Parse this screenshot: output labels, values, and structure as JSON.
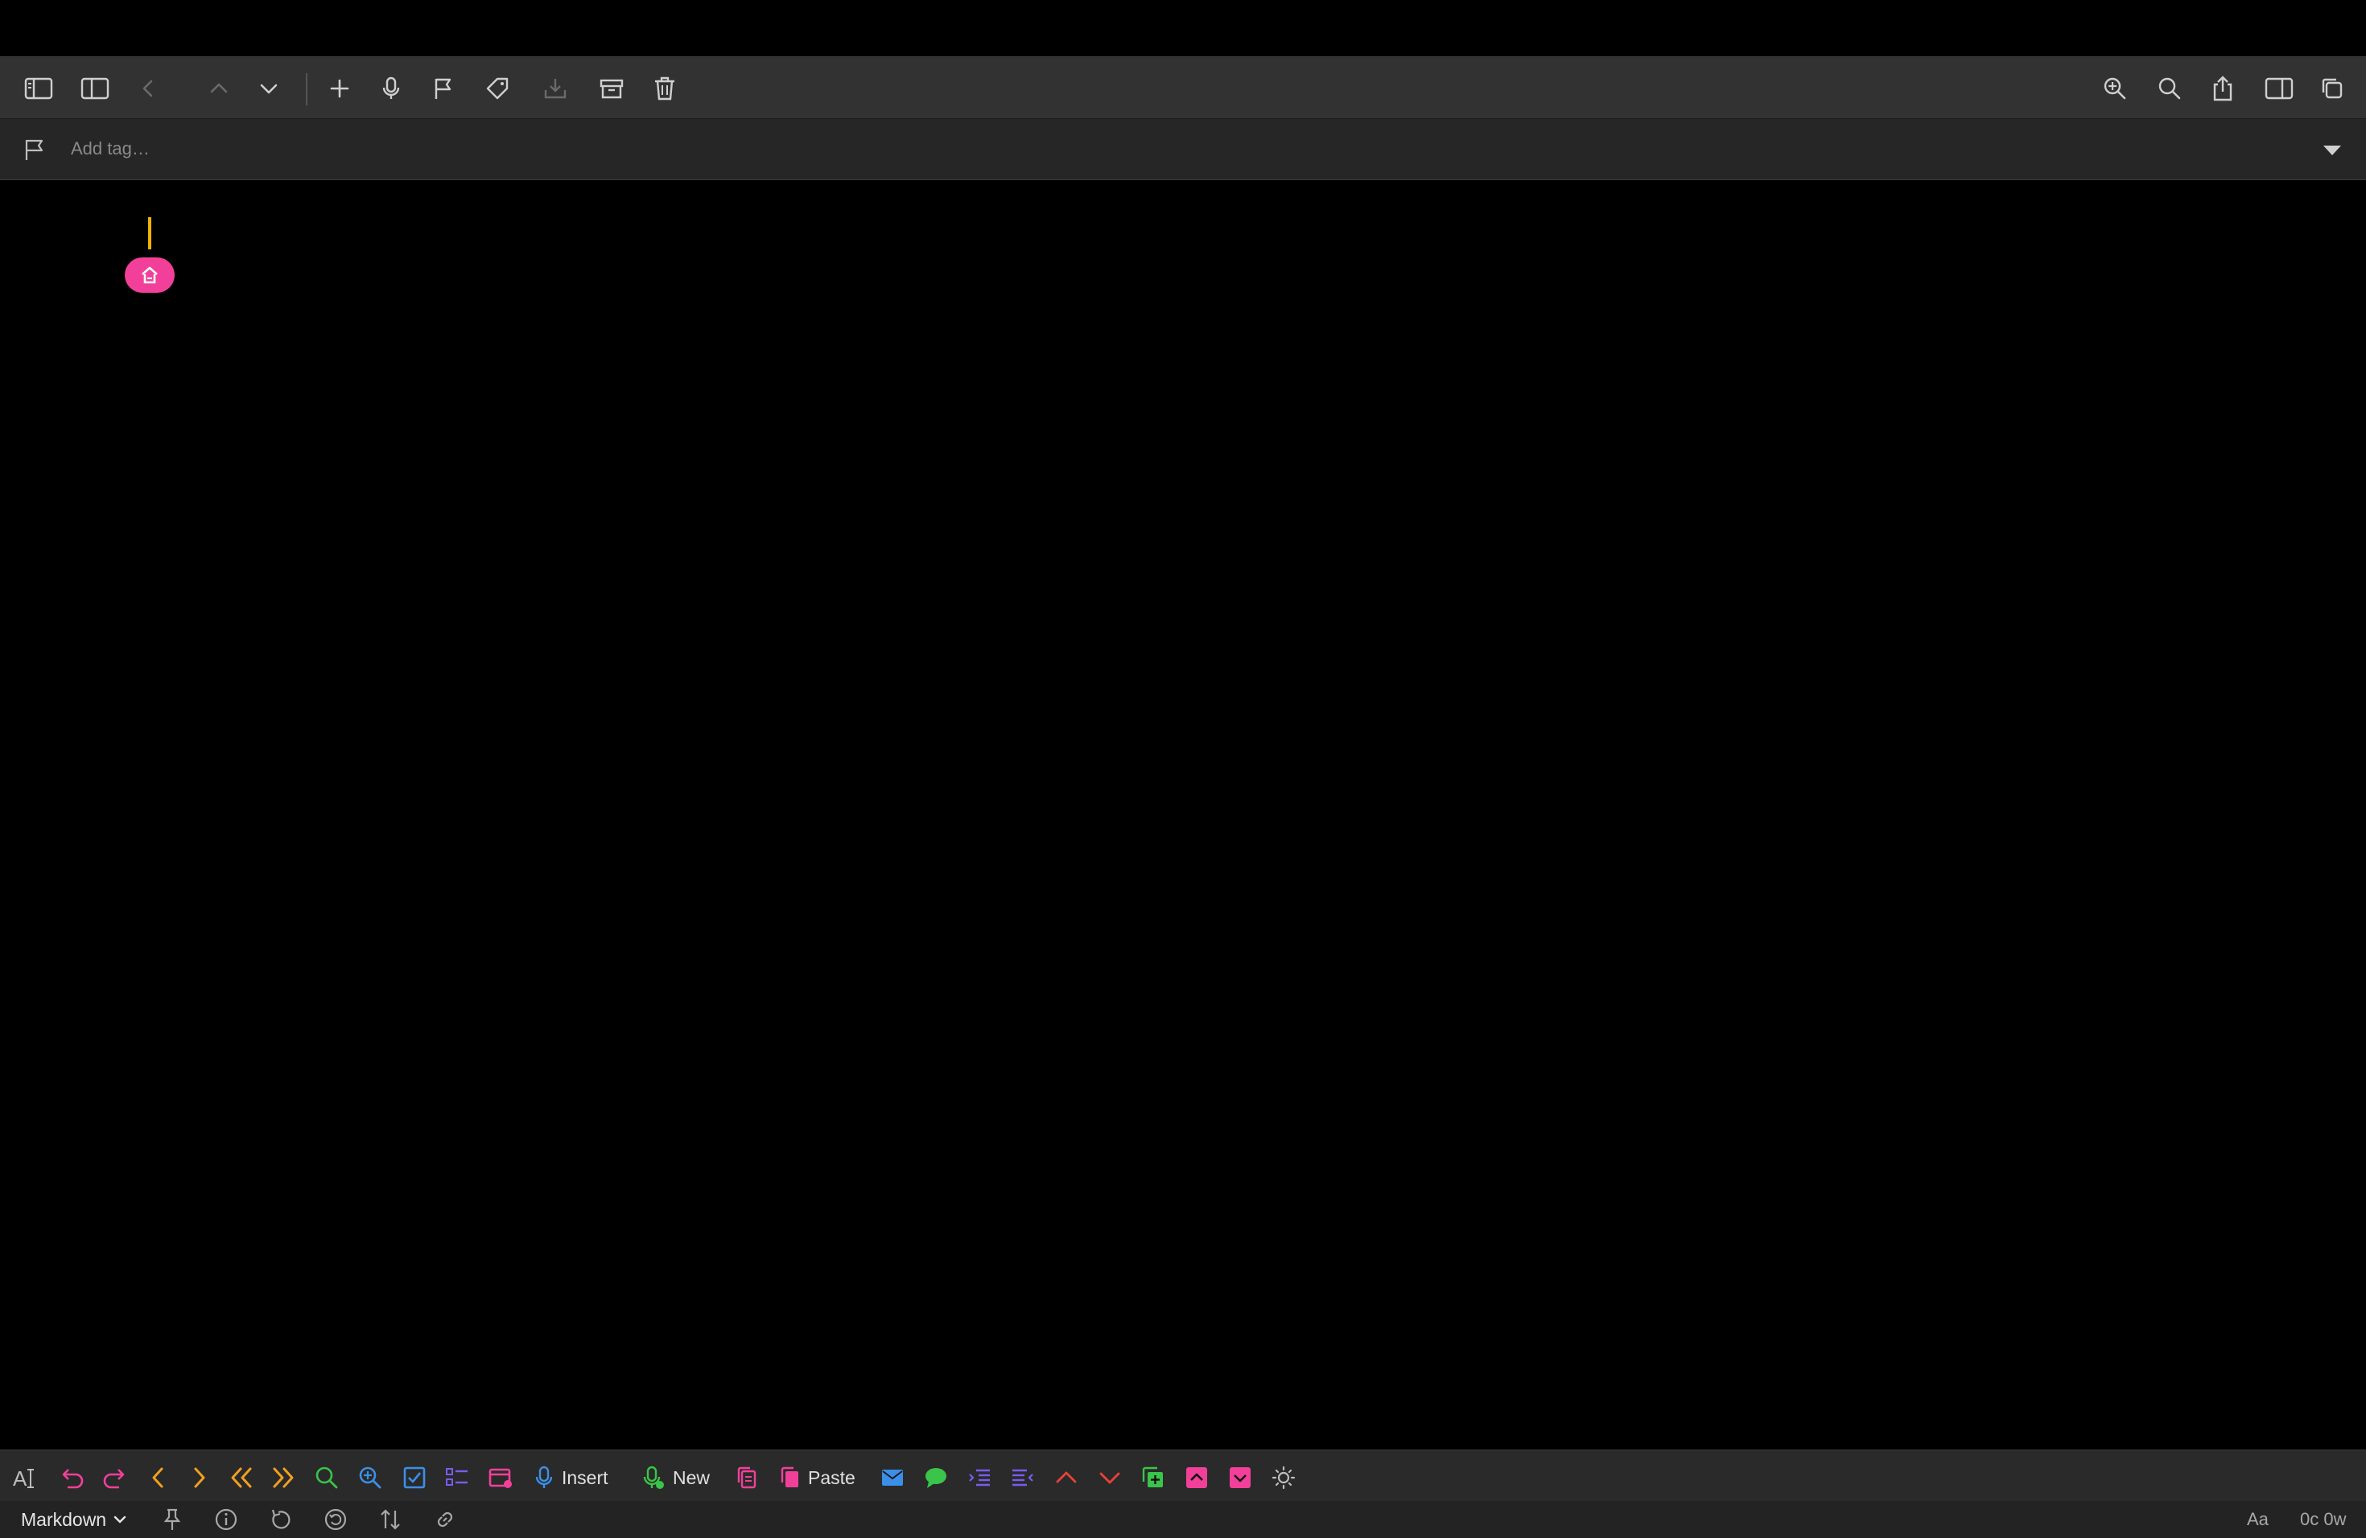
{
  "toolbar": {
    "icons": [
      "sidebar-toggle-icon",
      "sidebar-single-icon",
      "chevron-left-icon",
      "chevron-up-icon",
      "chevron-down-icon",
      "plus-icon",
      "microphone-icon",
      "flag-icon",
      "tag-icon",
      "tray-download-icon",
      "archive-box-icon",
      "trash-icon",
      "zoom-in-icon",
      "search-icon",
      "share-icon",
      "split-view-icon",
      "window-copy-icon"
    ]
  },
  "tagbar": {
    "placeholder": "Add tag…"
  },
  "editor": {
    "content": "",
    "cursor_color": "#f0b400",
    "badge_color": "#f2409a"
  },
  "actionbar": {
    "insert_label": "Insert",
    "new_label": "New",
    "paste_label": "Paste"
  },
  "statusbar": {
    "mode": "Markdown",
    "font_label": "Aa",
    "counts": "0c 0w"
  },
  "colors": {
    "pink": "#f2409a",
    "orange": "#f0a020",
    "green": "#3ac44a",
    "blue": "#3b8fe8",
    "purple": "#7a5cf0",
    "red": "#e8423a"
  }
}
